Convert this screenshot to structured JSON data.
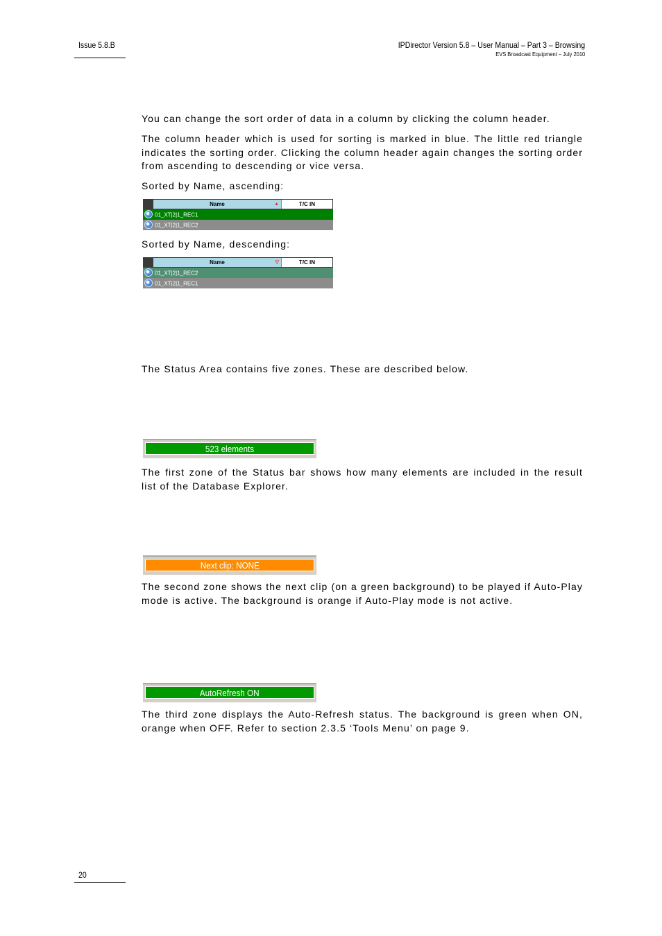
{
  "header": {
    "issue": "Issue 5.8.B",
    "title": "IPDirector Version 5.8 – User Manual – Part 3 – Browsing",
    "subtitle": "EVS Broadcast Equipment – July 2010"
  },
  "paragraphs": {
    "p1": "You can change the sort order of data in a column by clicking the column header.",
    "p2": "The column header which is used for sorting is marked in blue. The little red triangle indicates the sorting order. Clicking the column header again changes the sorting order from ascending to descending or vice versa.",
    "p3": "Sorted by Name, ascending:",
    "p4": "Sorted by Name, descending:",
    "p5": "The Status Area contains five zones. These are described below.",
    "p6": "The first zone of the Status bar shows how many elements are included in the result list of the Database Explorer.",
    "p7": "The second zone shows the next clip (on a green background) to be played if Auto-Play mode is active. The background is orange if Auto-Play mode is not active.",
    "p8": "The third zone displays the Auto-Refresh status. The background is green when ON, orange when OFF. Refer to section 2.3.5 ‘Tools Menu’ on page 9."
  },
  "grid_ascending": {
    "columns": [
      "Name",
      "T/C IN"
    ],
    "sort_icon": "triangle-up-icon",
    "sort_glyph": "▲",
    "rows": [
      {
        "name": "01_XT|2|1_REC1",
        "bg": "#008000"
      },
      {
        "name": "01_XT|2|1_REC2",
        "bg": "#8c8c8c"
      }
    ]
  },
  "grid_descending": {
    "columns": [
      "Name",
      "T/C IN"
    ],
    "sort_icon": "triangle-down-icon",
    "sort_glyph": "▽",
    "rows": [
      {
        "name": "01_XT|2|1_REC2",
        "bg": "#4f8f72"
      },
      {
        "name": "01_XT|2|1_REC1",
        "bg": "#8c8c8c"
      }
    ]
  },
  "status_zones": [
    {
      "label": "523 elements",
      "bg": "#009900"
    },
    {
      "label": "Next clip: NONE",
      "bg": "#ff8c00"
    },
    {
      "label": "AutoRefresh ON",
      "bg": "#009900"
    }
  ],
  "footer": {
    "page_number": "20"
  }
}
